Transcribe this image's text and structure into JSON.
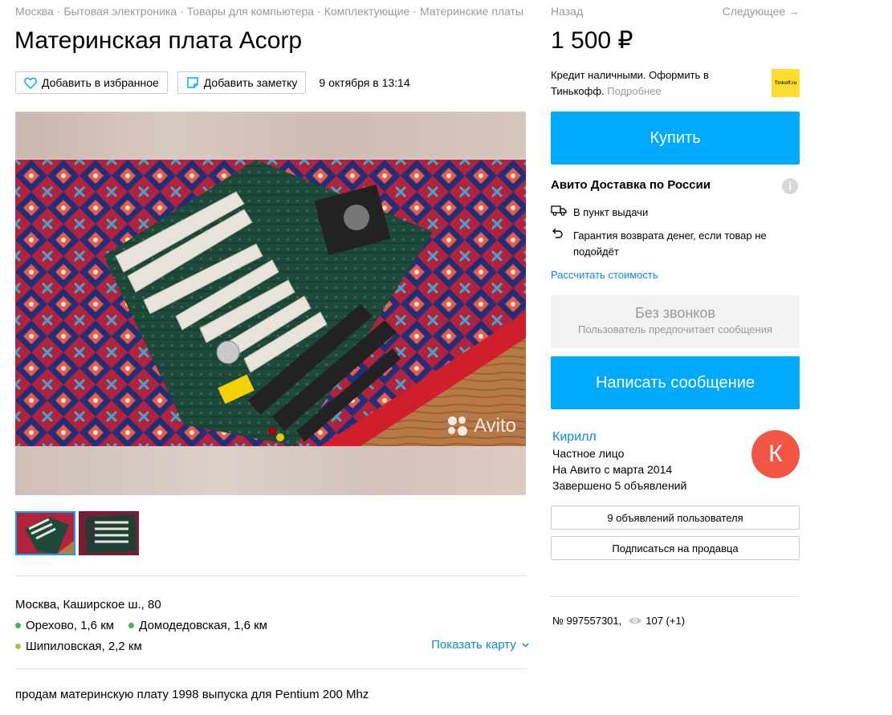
{
  "breadcrumbs": [
    "Москва",
    "Бытовая электроника",
    "Товары для компьютера",
    "Комплектующие",
    "Материнские платы"
  ],
  "breadcrumb_sep": "·",
  "title": "Материнская плата Acorp",
  "actions": {
    "favorite_label": "Добавить в избранное",
    "note_label": "Добавить заметку",
    "date": "9 октября в 13:14"
  },
  "gallery": {
    "watermark": "Avito",
    "thumb_count": 2
  },
  "location": {
    "address": "Москва, Каширское ш., 80",
    "metro": [
      {
        "name": "Орехово, 1,6 км",
        "color": "#4caf50"
      },
      {
        "name": "Домодедовская, 1,6 км",
        "color": "#4caf50"
      },
      {
        "name": "Шипиловская, 2,2 км",
        "color": "#a6c63c"
      }
    ],
    "show_map": "Показать карту"
  },
  "description": "продам материнскую плату 1998 выпуска для Pentium 200 Mhz",
  "nav": {
    "back": "Назад",
    "next": "Следующее →"
  },
  "price": "1 500 ₽",
  "credit": {
    "text": "Кредит наличными. Оформить в Тинькофф.",
    "more": "Подробнее",
    "logo_text": "Tinkoff.ru",
    "logo_color": "#ffdd2d"
  },
  "buy_label": "Купить",
  "delivery": {
    "title": "Авито Доставка по России",
    "info_icon": "i",
    "item1": "В пункт выдачи",
    "item2": "Гарантия возврата денег, если товар не подойдёт",
    "calc_link": "Рассчитать стоимость"
  },
  "no_calls": {
    "title": "Без звонков",
    "subtitle": "Пользователь предпочитает сообщения"
  },
  "message_label": "Написать сообщение",
  "seller": {
    "name": "Кирилл",
    "type": "Частное лицо",
    "since": "На Авито с марта 2014",
    "completed": "Завершено 5 объявлений",
    "avatar_letter": "К",
    "avatar_color": "#f25543"
  },
  "seller_ads_label": "9 объявлений пользователя",
  "subscribe_label": "Подписаться на продавца",
  "meta": {
    "id": "№ 997557301,",
    "views": "107 (+1)"
  },
  "colors": {
    "accent": "#00aaff",
    "link": "#0a8ad6",
    "muted": "#999999"
  }
}
